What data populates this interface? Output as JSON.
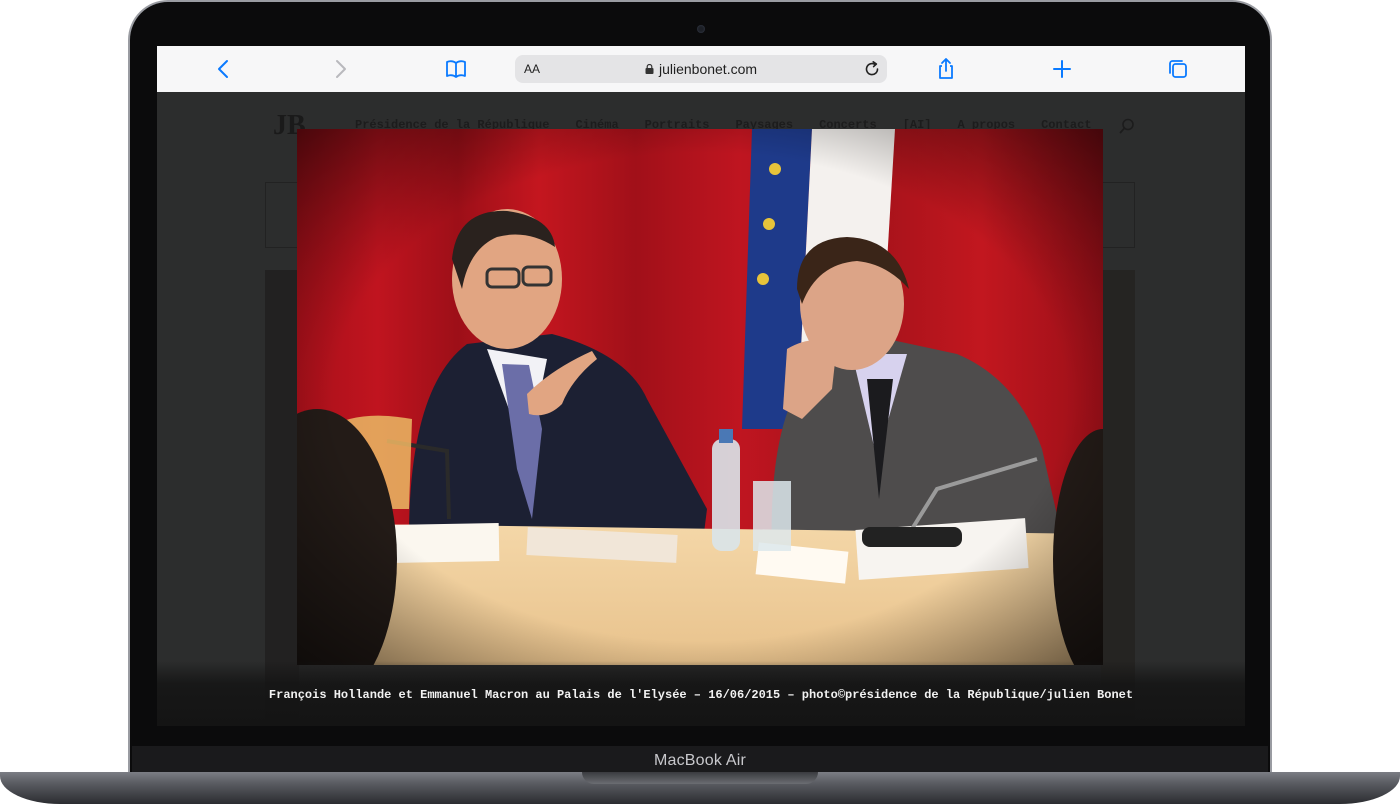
{
  "device": {
    "label": "MacBook Air"
  },
  "browser": {
    "url": "julienbonet.com",
    "text_size_label": "AA",
    "icons": {
      "back": "chevron-left-icon",
      "forward": "chevron-right-icon",
      "bookmarks": "book-icon",
      "reload": "reload-icon",
      "share": "share-icon",
      "new_tab": "plus-icon",
      "tabs": "tabs-icon"
    },
    "accent": "#0a7aff"
  },
  "site": {
    "logo": "JB",
    "nav": [
      "Présidence de la République",
      "Cinéma",
      "Portraits",
      "Paysages",
      "Concerts",
      "[AI]",
      "A propos",
      "Contact"
    ]
  },
  "lightbox": {
    "caption": "François Hollande et Emmanuel Macron au Palais de l'Elysée – 16/06/2015 – photo©présidence de la République/julien Bonet"
  }
}
